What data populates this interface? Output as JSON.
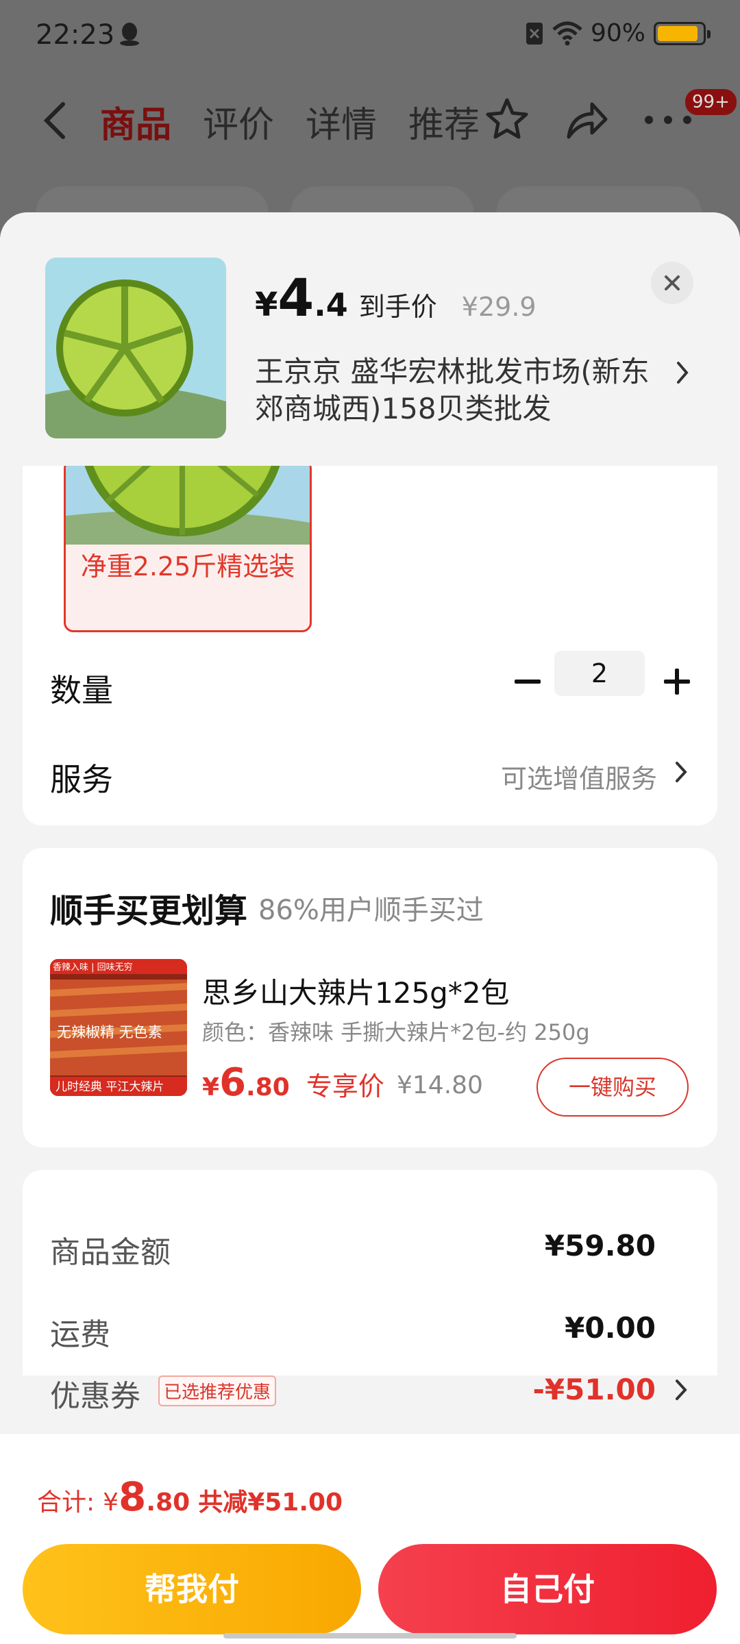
{
  "status_bar": {
    "time": "22:23",
    "battery": "90%"
  },
  "background_nav": {
    "tabs": [
      "商品",
      "评价",
      "详情",
      "推荐"
    ],
    "cart_badge": "99+"
  },
  "sheet": {
    "product": {
      "price_currency": "¥",
      "price_int": "4",
      "price_dec": ".4",
      "price_tag": "到手价",
      "original_price": "¥29.9",
      "shop": "王京京  盛华宏林批发市场(新东郊商城西)158贝类批发"
    },
    "variant": {
      "label": "净重2.25斤精选装",
      "selected": true
    },
    "quantity": {
      "label": "数量",
      "value": "2"
    },
    "service": {
      "label": "服务",
      "value": "可选增值服务"
    },
    "addon": {
      "title": "顺手买更划算",
      "subtitle": "86%用户顺手买过",
      "image_text_top": "香辣入味 | 回味无穷",
      "image_text_mid": "无辣椒精 无色素",
      "image_text_bottom": "儿时经典 平江大辣片",
      "name": "思乡山大辣片125g*2包",
      "spec": "颜色：香辣味 手撕大辣片*2包-约 250g",
      "price_currency": "¥",
      "price_int": "6",
      "price_dec": ".80",
      "price_tag": "专享价",
      "original_price": "¥14.80",
      "button": "一键购买"
    },
    "summary": {
      "goods_label": "商品金额",
      "goods_value": "¥59.80",
      "shipping_label": "运费",
      "shipping_value": "¥0.00",
      "coupon_label": "优惠券",
      "coupon_tag": "已选推荐优惠",
      "coupon_value": "-¥51.00"
    },
    "footer": {
      "total_label": "合计:",
      "total_currency": "¥",
      "total_int": "8",
      "total_dec": ".80",
      "saved": "共减¥51.00",
      "help_pay": "帮我付",
      "self_pay": "自己付"
    }
  },
  "colors": {
    "accent_red": "#e0322a",
    "help_button": "#fbb60f",
    "pay_button": "#f23040",
    "battery": "#f7b500"
  }
}
